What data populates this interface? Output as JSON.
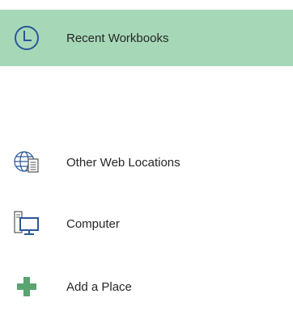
{
  "nav": {
    "items": [
      {
        "label": "Recent Workbooks",
        "icon": "clock-icon",
        "selected": true
      },
      {
        "label": "Other Web Locations",
        "icon": "globe-document-icon",
        "selected": false
      },
      {
        "label": "Computer",
        "icon": "computer-icon",
        "selected": false
      },
      {
        "label": "Add a Place",
        "icon": "plus-icon",
        "selected": false
      }
    ]
  },
  "colors": {
    "selected_background": "#a6d8b8",
    "icon_blue": "#2b5797",
    "icon_green": "#5aa470",
    "text": "#262626"
  }
}
